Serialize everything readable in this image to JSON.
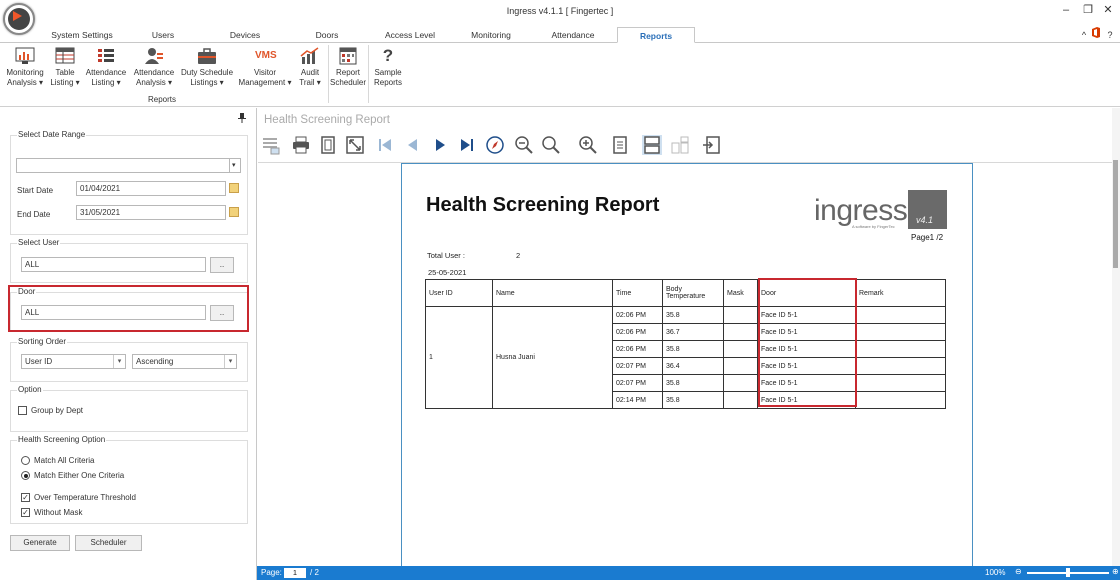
{
  "window": {
    "title": "Ingress v4.1.1 [ Fingertec ]",
    "minimize_glyph": "–",
    "restore_glyph": "❐",
    "close_glyph": "✕",
    "collapse_glyph": "^",
    "help_glyph": "?"
  },
  "tabs": [
    "System Settings",
    "Users",
    "Devices",
    "Doors",
    "Access Level",
    "Monitoring",
    "Attendance",
    "Reports"
  ],
  "active_tab": "Reports",
  "ribbon": {
    "buttons": [
      {
        "line1": "Monitoring",
        "line2": "Analysis ▾",
        "icon": "monitoring-analysis-icon"
      },
      {
        "line1": "Table",
        "line2": "Listing ▾",
        "icon": "table-listing-icon"
      },
      {
        "line1": "Attendance",
        "line2": "Listing ▾",
        "icon": "attendance-listing-icon"
      },
      {
        "line1": "Attendance",
        "line2": "Analysis ▾",
        "icon": "attendance-analysis-icon"
      },
      {
        "line1": "Duty Schedule",
        "line2": "Listings ▾",
        "icon": "duty-schedule-icon"
      },
      {
        "line1": "Visitor",
        "line2": "Management ▾",
        "icon": "vms-icon",
        "icon_text": "VMS"
      },
      {
        "line1": "Audit",
        "line2": "Trail ▾",
        "icon": "audit-trail-icon"
      },
      {
        "line1": "Report",
        "line2": "Scheduler",
        "icon": "report-scheduler-icon"
      },
      {
        "line1": "Sample",
        "line2": "Reports",
        "icon": "sample-reports-icon",
        "icon_text": "?"
      }
    ],
    "group_label": "Reports"
  },
  "left_panel": {
    "date_range": {
      "group_label": "Select Date Range",
      "preset_value": "",
      "start_label": "Start Date",
      "start_value": "01/04/2021",
      "end_label": "End Date",
      "end_value": "31/05/2021"
    },
    "user": {
      "group_label": "Select User",
      "value": "ALL",
      "browse_label": ".."
    },
    "door": {
      "group_label": "Door",
      "value": "ALL",
      "browse_label": ".."
    },
    "sorting": {
      "group_label": "Sorting Order",
      "field_value": "User ID",
      "order_value": "Ascending"
    },
    "option": {
      "group_label": "Option",
      "group_by_dept_label": "Group by Dept",
      "group_by_dept_checked": false
    },
    "health": {
      "group_label": "Health Screening Option",
      "match_all_label": "Match All Criteria",
      "match_either_label": "Match Either One Criteria",
      "selected": "match_either",
      "over_temp_label": "Over Temperature Threshold",
      "over_temp_checked": true,
      "without_mask_label": "Without Mask",
      "without_mask_checked": true
    },
    "generate_label": "Generate",
    "scheduler_label": "Scheduler"
  },
  "viewer": {
    "title": "Health Screening Report",
    "toolbar_icons": [
      "export-options-icon",
      "print-icon",
      "page-setup-icon",
      "fit-page-icon",
      "first-page-icon",
      "previous-page-icon",
      "next-page-icon",
      "last-page-icon",
      "navigate-icon",
      "zoom-out-icon",
      "zoom-icon",
      "zoom-in-icon",
      "document-view-icon",
      "single-page-icon",
      "multi-page-icon",
      "export-icon"
    ]
  },
  "report": {
    "title": "Health Screening Report",
    "logo_text": "ingress",
    "logo_subtext": "A software by FingerTec",
    "logo_version": "v4.1",
    "page_label": "Page1 /2",
    "total_user_label": "Total User :",
    "total_user_value": "2",
    "date": "25-05-2021",
    "columns": [
      "User ID",
      "Name",
      "Time",
      "Body Temperature",
      "Mask",
      "Door",
      "Remark"
    ],
    "group": {
      "user_id": "1",
      "name": "Husna Juani"
    },
    "rows": [
      {
        "time": "02:06 PM",
        "temp": "35.8",
        "mask": "",
        "door": "Face ID 5-1",
        "remark": ""
      },
      {
        "time": "02:06 PM",
        "temp": "36.7",
        "mask": "",
        "door": "Face ID 5-1",
        "remark": ""
      },
      {
        "time": "02:06 PM",
        "temp": "35.8",
        "mask": "",
        "door": "Face ID 5-1",
        "remark": ""
      },
      {
        "time": "02:07 PM",
        "temp": "36.4",
        "mask": "",
        "door": "Face ID 5-1",
        "remark": ""
      },
      {
        "time": "02:07 PM",
        "temp": "35.8",
        "mask": "",
        "door": "Face ID 5-1",
        "remark": ""
      },
      {
        "time": "02:14 PM",
        "temp": "35.8",
        "mask": "",
        "door": "Face ID 5-1",
        "remark": ""
      }
    ]
  },
  "status": {
    "page_label": "Page:",
    "page_value": "1",
    "page_total": "/ 2",
    "zoom": "100%",
    "zoom_minus": "⊖",
    "zoom_plus": "⊕",
    "zoom_level": 0.5
  },
  "colors": {
    "accent": "#1a7bd0",
    "highlight": "#c8282f",
    "tab_active": "#2a6fb8"
  }
}
